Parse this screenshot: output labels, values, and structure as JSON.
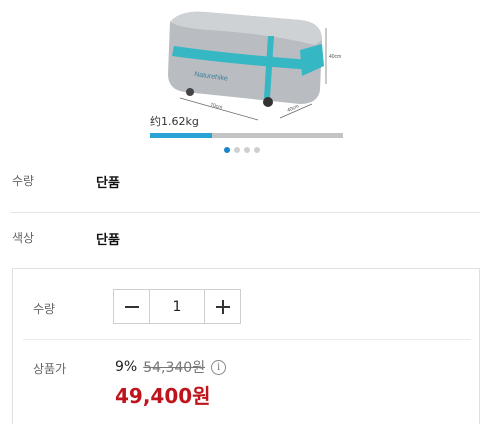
{
  "product": {
    "weight": "约1.62kg",
    "dim_width": "70cm",
    "dim_depth": "40cm",
    "dim_height": "40cm",
    "brand_print": "Naturehike",
    "weight_bar_fraction": 0.32,
    "carousel_dots": 4,
    "carousel_active_index": 0
  },
  "rows": {
    "quantity_label": "수량",
    "quantity_value": "단품",
    "color_label": "색상",
    "color_value": "단품"
  },
  "option": {
    "quantity_label": "수량",
    "quantity_value": "1",
    "minus_symbol": "−",
    "plus_symbol": "+",
    "price_label": "상품가",
    "discount": "9%",
    "original_price": "54,340원",
    "info_symbol": "i",
    "final_price": "49,400원"
  },
  "colors": {
    "accent_blue": "#2aa3d6",
    "price_red": "#c0141c",
    "bag_grey": "#b9bcc0",
    "strap_teal": "#35b7c4"
  }
}
